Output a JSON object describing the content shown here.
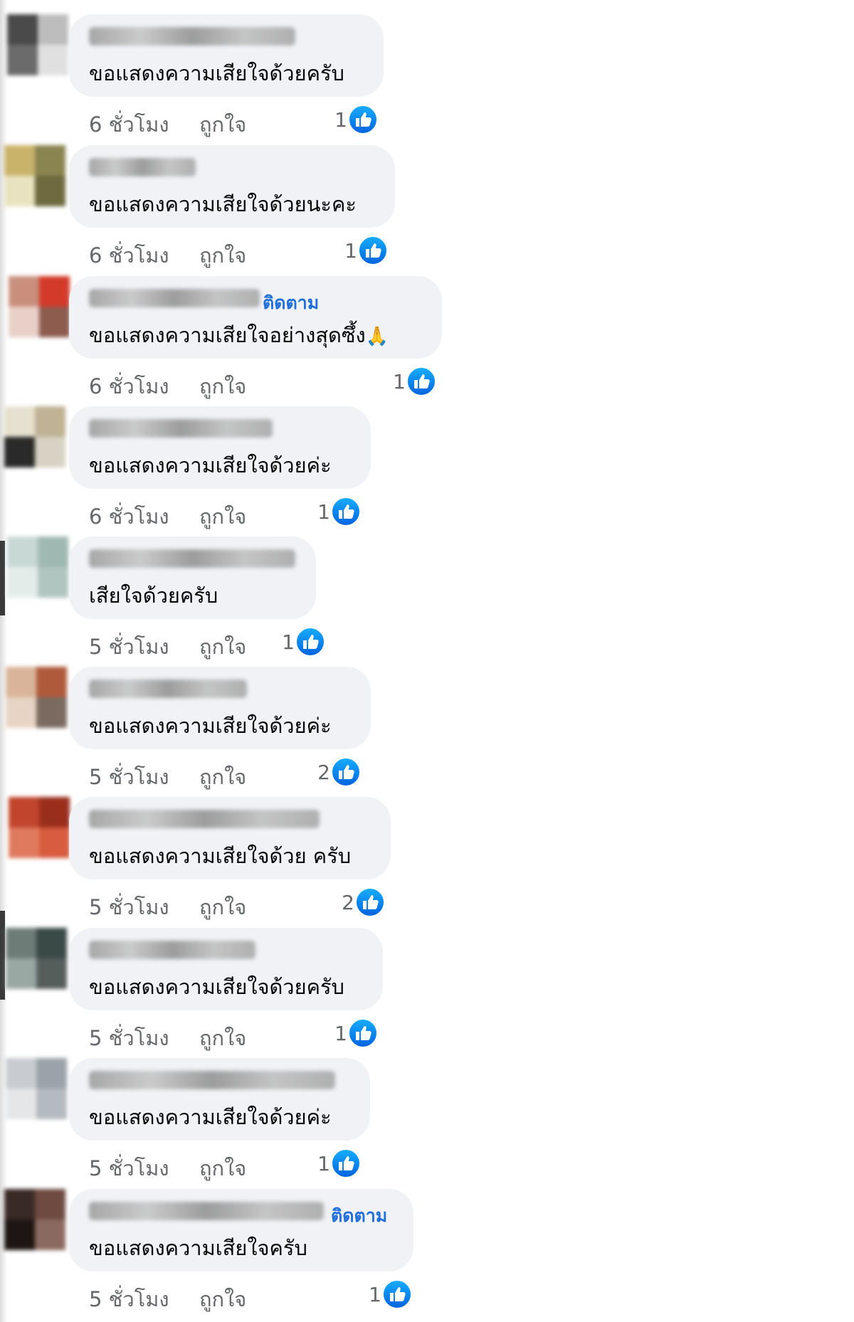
{
  "comments": [
    {
      "text": "ขอแสดงความเสียใจด้วยครับ",
      "time": "6 ชั่วโมง",
      "like": "ถูกใจ",
      "reactions": "1",
      "reaction_icon": "like-icon",
      "avatar": [
        "#4a4a4a",
        "#bdbdbd",
        "#6b6b6b",
        "#e0e0e0"
      ]
    },
    {
      "text": "ขอแสดงความเสียใจด้วยนะคะ",
      "time": "6 ชั่วโมง",
      "like": "ถูกใจ",
      "reactions": "1",
      "reaction_icon": "like-icon",
      "avatar": [
        "#c9b36a",
        "#8a8450",
        "#e8e2c0",
        "#6f6a40"
      ]
    },
    {
      "follow": "ติดตาม",
      "text": "ขอแสดงความเสียใจอย่างสุดซึ้ง",
      "emoji": "🙏",
      "time": "6 ชั่วโมง",
      "like": "ถูกใจ",
      "reactions": "1",
      "reaction_icon": "like-icon",
      "avatar": [
        "#c98f7c",
        "#d43a2a",
        "#e8d0c8",
        "#8e5c4f"
      ]
    },
    {
      "text": "ขอแสดงความเสียใจด้วยค่ะ",
      "time": "6 ชั่วโมง",
      "like": "ถูกใจ",
      "reactions": "1",
      "reaction_icon": "like-icon",
      "avatar": [
        "#e6e0d0",
        "#bfb295",
        "#2a2a2a",
        "#d8d2c4"
      ]
    },
    {
      "text": "เสียใจด้วยครับ",
      "time": "5 ชั่วโมง",
      "like": "ถูกใจ",
      "reactions": "1",
      "reaction_icon": "like-icon",
      "avatar": [
        "#c8d8d4",
        "#a0b8b2",
        "#e4ecea",
        "#b0c4c0"
      ]
    },
    {
      "text": "ขอแสดงความเสียใจด้วยค่ะ",
      "time": "5 ชั่วโมง",
      "like": "ถูกใจ",
      "reactions": "2",
      "reaction_icon": "like-icon",
      "avatar": [
        "#d9b49a",
        "#b05a3c",
        "#e8d4c4",
        "#7a6a60"
      ]
    },
    {
      "text": "ขอแสดงความเสียใจด้วย ครับ",
      "time": "5 ชั่วโมง",
      "like": "ถูกใจ",
      "reactions": "2",
      "reaction_icon": "like-icon",
      "avatar": [
        "#c0452c",
        "#9a2e1c",
        "#e07a5e",
        "#d85c40"
      ]
    },
    {
      "text": "ขอแสดงความเสียใจด้วยครับ",
      "time": "5 ชั่วโมง",
      "like": "ถูกใจ",
      "reactions": "1",
      "reaction_icon": "like-icon",
      "avatar": [
        "#6e7c78",
        "#3a4a46",
        "#9aa8a4",
        "#565e5c"
      ]
    },
    {
      "text": "ขอแสดงความเสียใจด้วยค่ะ",
      "time": "5 ชั่วโมง",
      "like": "ถูกใจ",
      "reactions": "1",
      "reaction_icon": "like-icon",
      "avatar": [
        "#c8ccd0",
        "#9aa2aa",
        "#e4e6e8",
        "#b4bac0"
      ]
    },
    {
      "follow": "ติดตาม",
      "text": "ขอแสดงความเสียใจครับ",
      "time": "5 ชั่วโมง",
      "like": "ถูกใจ",
      "reactions": "1",
      "reaction_icon": "like-icon",
      "avatar": [
        "#3a2a26",
        "#6e4a40",
        "#1e1614",
        "#8a6a60"
      ]
    }
  ],
  "colors": {
    "bubble": "#f0f2f5",
    "text": "#050505",
    "meta": "#65676b",
    "follow": "#216fdb",
    "like_gradient_top": "#18AFFF",
    "like_gradient_bottom": "#0062DF"
  }
}
